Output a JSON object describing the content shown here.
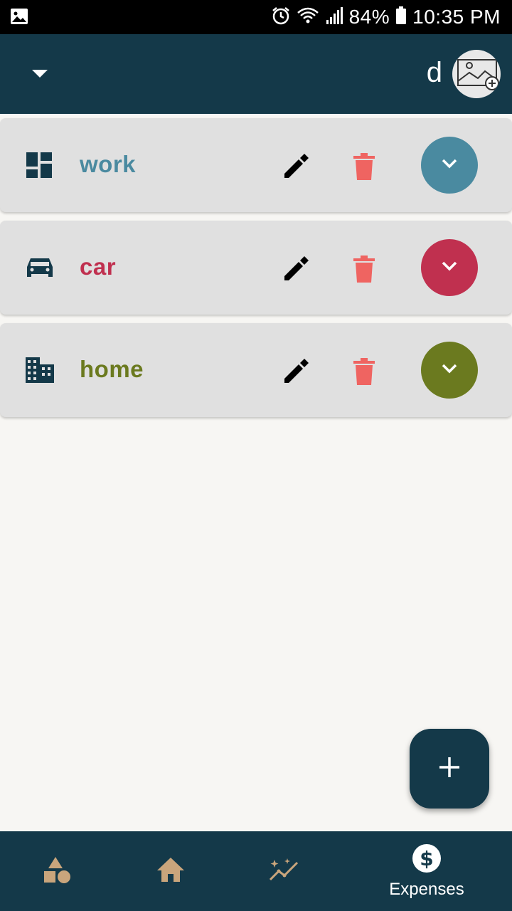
{
  "status_bar": {
    "battery": "84%",
    "time": "10:35 PM",
    "icons": [
      "image-icon",
      "alarm-icon",
      "wifi-icon",
      "signal-icon",
      "battery-icon"
    ]
  },
  "app_bar": {
    "user_initial": "d",
    "icons": [
      "dropdown-arrow-icon",
      "add-photo-icon"
    ]
  },
  "categories": [
    {
      "label": "work",
      "color": "#4a8aa0",
      "icon": "dashboard-icon"
    },
    {
      "label": "car",
      "color": "#c0304f",
      "icon": "car-icon"
    },
    {
      "label": "home",
      "color": "#6b7a1f",
      "icon": "building-icon"
    }
  ],
  "actions": {
    "edit_icon": "pencil-icon",
    "delete_icon": "trash-icon",
    "delete_color": "#ef6461",
    "expand_icon": "chevron-down-icon"
  },
  "fab": {
    "icon": "plus-icon"
  },
  "bottom_nav": {
    "items": [
      {
        "icon": "shapes-icon",
        "label": ""
      },
      {
        "icon": "home-icon",
        "label": ""
      },
      {
        "icon": "insights-icon",
        "label": ""
      },
      {
        "icon": "dollar-icon",
        "label": "Expenses",
        "active": true
      }
    ],
    "accent": "#c9a57c"
  },
  "theme": {
    "primary": "#143949",
    "background": "#f7f6f3",
    "card": "#e0e0e0"
  }
}
